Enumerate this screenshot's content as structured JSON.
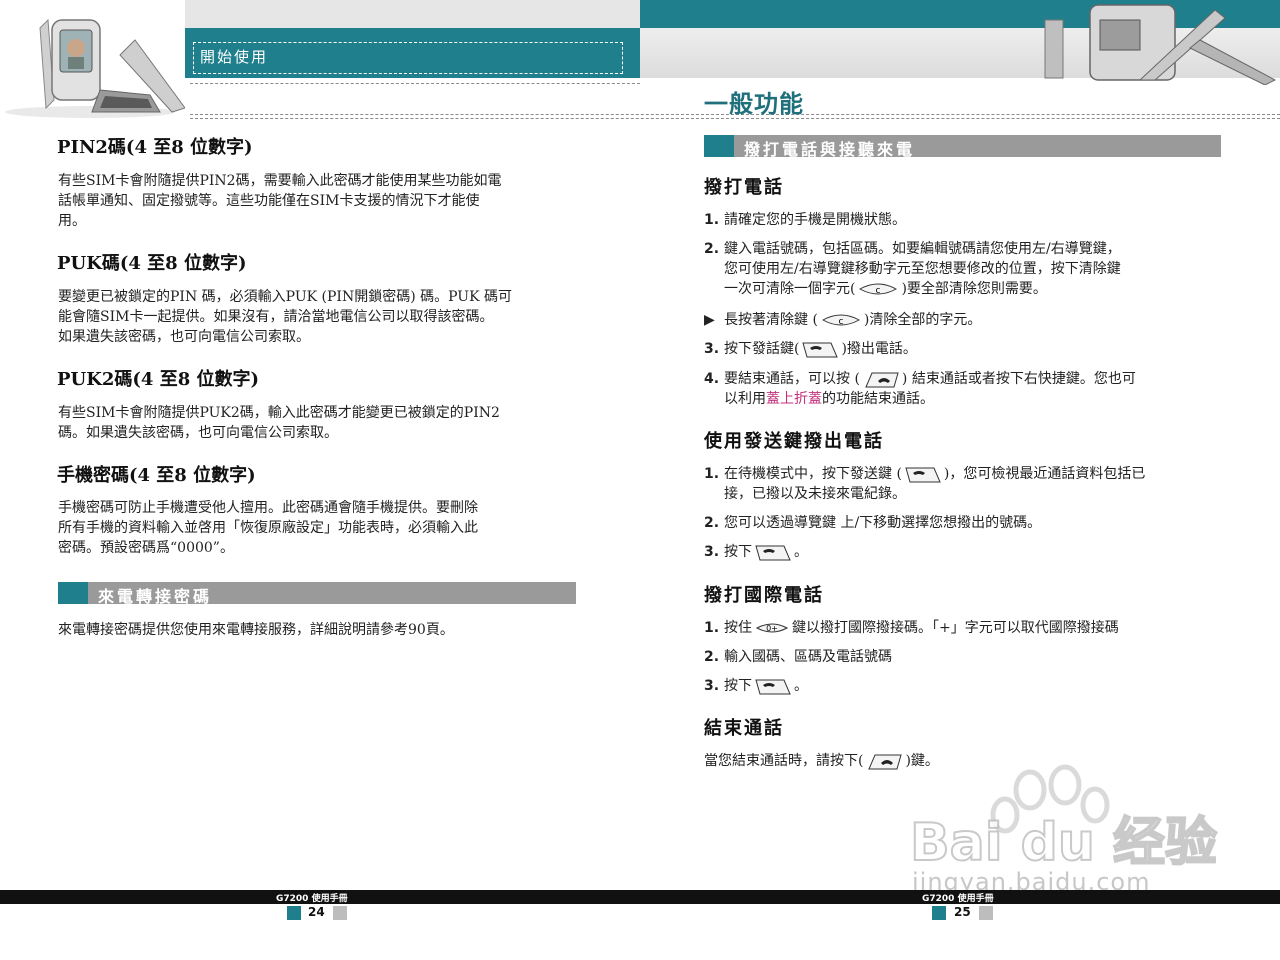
{
  "header": {
    "section_label": "開始使用",
    "chapter_title": "一般功能"
  },
  "left": {
    "pin2": {
      "title": "PIN2碼(4 至8 位數字)",
      "lines": [
        "有些SIM卡會附隨提供PIN2碼，需要輸入此密碼才能使用某些功能如電",
        "話帳單通知、固定撥號等。這些功能僅在SIM卡支援的情況下才能使",
        "用。"
      ]
    },
    "puk": {
      "title": "PUK碼(4 至8 位數字)",
      "lines": [
        "要變更已被鎖定的PIN 碼，必須輸入PUK (PIN開鎖密碼) 碼。PUK 碼可",
        "能會隨SIM卡一起提供。如果沒有，請洽當地電信公司以取得該密碼。",
        "如果遺失該密碼，也可向電信公司索取。"
      ]
    },
    "puk2": {
      "title": "PUK2碼(4 至8 位數字)",
      "lines": [
        "有些SIM卡會附隨提供PUK2碼，輸入此密碼才能變更已被鎖定的PIN2",
        "碼。如果遺失該密碼，也可向電信公司索取。"
      ]
    },
    "phone_pw": {
      "title": "手機密碼(4 至8 位數字)",
      "lines": [
        "手機密碼可防止手機遭受他人擅用。此密碼通會隨手機提供。要刪除",
        "所有手機的資料輸入並啓用「恢復原廠設定」功能表時，必須輸入此",
        "密碼。預設密碼爲“0000”。"
      ]
    },
    "forward_banner": "來電轉接密碼",
    "forward_text": "來電轉接密碼提供您使用來電轉接服務，詳細說明請參考90頁。"
  },
  "right": {
    "banner": "撥打電話與接聽來電",
    "call": {
      "title": "撥打電話",
      "n1": "1.",
      "t1": "請確定您的手機是開機狀態。",
      "n2": "2.",
      "t2a": "鍵入電話號碼，包括區碼。如要編輯號碼請您使用左/右導覽鍵，",
      "t2b": "您可使用左/右導覽鍵移動字元至您想要修改的位置，按下清除鍵",
      "t2c_pre": "一次可清除一個字元(",
      "t2c_post": ")要全部清除您則需要。",
      "bullet": "▶",
      "tb_pre": "長按著清除鍵 (",
      "tb_post": ")清除全部的字元。",
      "n3": "3.",
      "t3_pre": "按下發話鍵(",
      "t3_post": ")撥出電話。",
      "n4": "4.",
      "t4a_pre": "要結束通話，可以按 (",
      "t4a_post": ") 結束通話或者按下右快捷鍵。您也可",
      "t4b_pre": "以利用",
      "t4b_pink": "蓋上折蓋",
      "t4b_post": "的功能結束通話。"
    },
    "send": {
      "title": "使用發送鍵撥出電話",
      "n1": "1.",
      "t1a_pre": "在待機模式中，按下發送鍵 (",
      "t1a_post": ")，您可檢視最近通話資料包括已",
      "t1b": "接，已撥以及未接來電紀錄。",
      "n2": "2.",
      "t2": "您可以透過導覽鍵 上/下移動選擇您想撥出的號碼。",
      "n3": "3.",
      "t3_pre": "按下",
      "t3_post": "。"
    },
    "intl": {
      "title": "撥打國際電話",
      "n1": "1.",
      "t1_pre": "按住",
      "t1_post": "鍵以撥打國際撥接碼。「+」字元可以取代國際撥接碼",
      "n2": "2.",
      "t2": "輸入國碼、區碼及電話號碼",
      "n3": "3.",
      "t3_pre": "按下",
      "t3_post": "。"
    },
    "end": {
      "title": "結束通話",
      "t_pre": "當您結束通話時，請按下(",
      "t_post": ")鍵。"
    }
  },
  "footer": {
    "left_title": "G7200 使用手冊",
    "left_page": "24",
    "right_title": "G7200 使用手冊",
    "right_page": "25"
  },
  "watermark": {
    "brand": "Bai du 经验",
    "url": "jingyan.baidu.com"
  },
  "colors": {
    "teal": "#1f7f8c",
    "banner_gray": "#9a9a9a",
    "title_teal": "#1f6f7c",
    "pink": "#c4307c"
  },
  "icons": [
    "phone-left-icon",
    "phone-right-icon",
    "clear-key-icon",
    "send-key-icon",
    "end-key-icon",
    "zero-key-icon",
    "baidu-paw-icon"
  ]
}
